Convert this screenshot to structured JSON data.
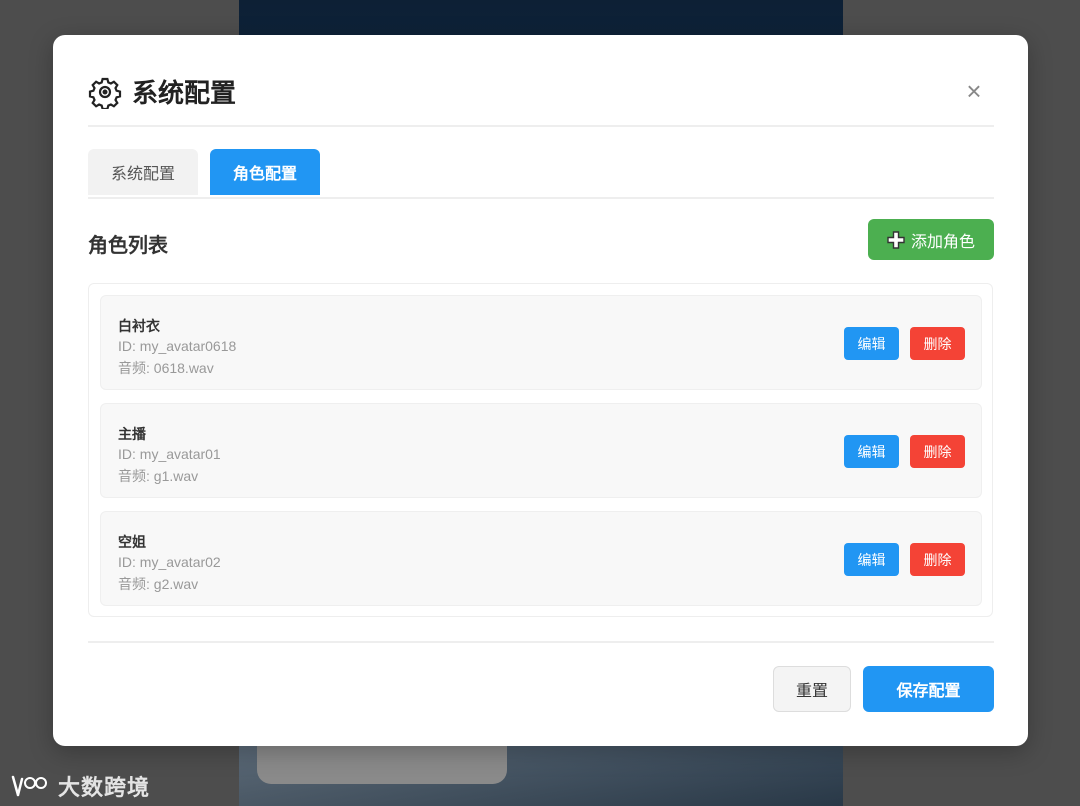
{
  "modal": {
    "title": "系统配置",
    "close_symbol": "×",
    "icons": {
      "title": "gear-icon",
      "close": "close-icon",
      "add": "plus-icon"
    }
  },
  "tabs": [
    {
      "label": "系统配置",
      "active": false
    },
    {
      "label": "角色配置",
      "active": true
    }
  ],
  "section": {
    "title": "角色列表",
    "add_button_label": "添加角色"
  },
  "roles": [
    {
      "name": "白衬衣",
      "id": "ID: my_avatar0618",
      "audio": "音频: 0618.wav",
      "edit_label": "编辑",
      "delete_label": "删除"
    },
    {
      "name": "主播",
      "id": "ID: my_avatar01",
      "audio": "音频: g1.wav",
      "edit_label": "编辑",
      "delete_label": "删除"
    },
    {
      "name": "空姐",
      "id": "ID: my_avatar02",
      "audio": "音频: g2.wav",
      "edit_label": "编辑",
      "delete_label": "删除"
    }
  ],
  "footer": {
    "reset_label": "重置",
    "save_label": "保存配置"
  },
  "watermark": {
    "text": "大数跨境"
  },
  "colors": {
    "primary": "#2196f3",
    "success": "#4caf50",
    "danger": "#f44336"
  }
}
